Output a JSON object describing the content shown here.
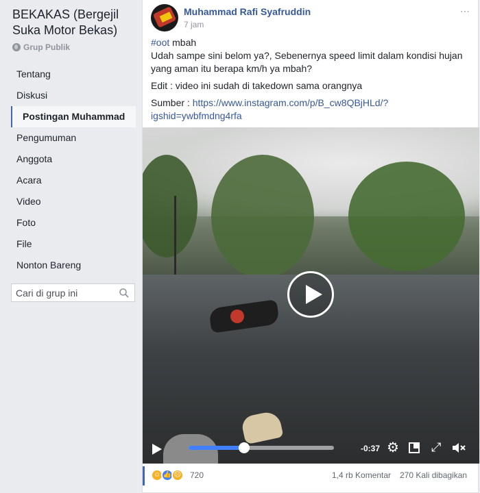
{
  "group": {
    "name": "BEKAKAS (Bergejil Suka Motor Bekas)",
    "type": "Grup Publik"
  },
  "sidebar": {
    "items": [
      {
        "label": "Tentang",
        "active": false
      },
      {
        "label": "Diskusi",
        "active": false
      },
      {
        "label": "Postingan Muhammad",
        "active": true
      },
      {
        "label": "Pengumuman",
        "active": false
      },
      {
        "label": "Anggota",
        "active": false
      },
      {
        "label": "Acara",
        "active": false
      },
      {
        "label": "Video",
        "active": false
      },
      {
        "label": "Foto",
        "active": false
      },
      {
        "label": "File",
        "active": false
      },
      {
        "label": "Nonton Bareng",
        "active": false
      }
    ],
    "search_placeholder": "Cari di grup ini"
  },
  "post": {
    "author": "Muhammad Rafi Syafruddin",
    "time": "7 jam",
    "hashtag": "#oot",
    "hashtag_suffix": " mbah",
    "body": "Udah sampe sini belom ya?, Sebenernya speed limit dalam kondisi hujan yang aman itu berapa km/h ya mbah?",
    "edit": "Edit : video ini sudah di takedown sama orangnya",
    "source_label": "Sumber : ",
    "source_link": "https://www.instagram.com/p/B_cw8QBjHLd/?igshid=ywbfmdng4rfa"
  },
  "video": {
    "time_remaining": "-0:37",
    "progress_fraction": 0.38
  },
  "footer": {
    "reaction_count": "720",
    "comments": "1,4 rb Komentar",
    "shares": "270 Kali dibagikan"
  },
  "colors": {
    "link": "#365899",
    "progress": "#4080ff",
    "background": "#e9ebee"
  }
}
